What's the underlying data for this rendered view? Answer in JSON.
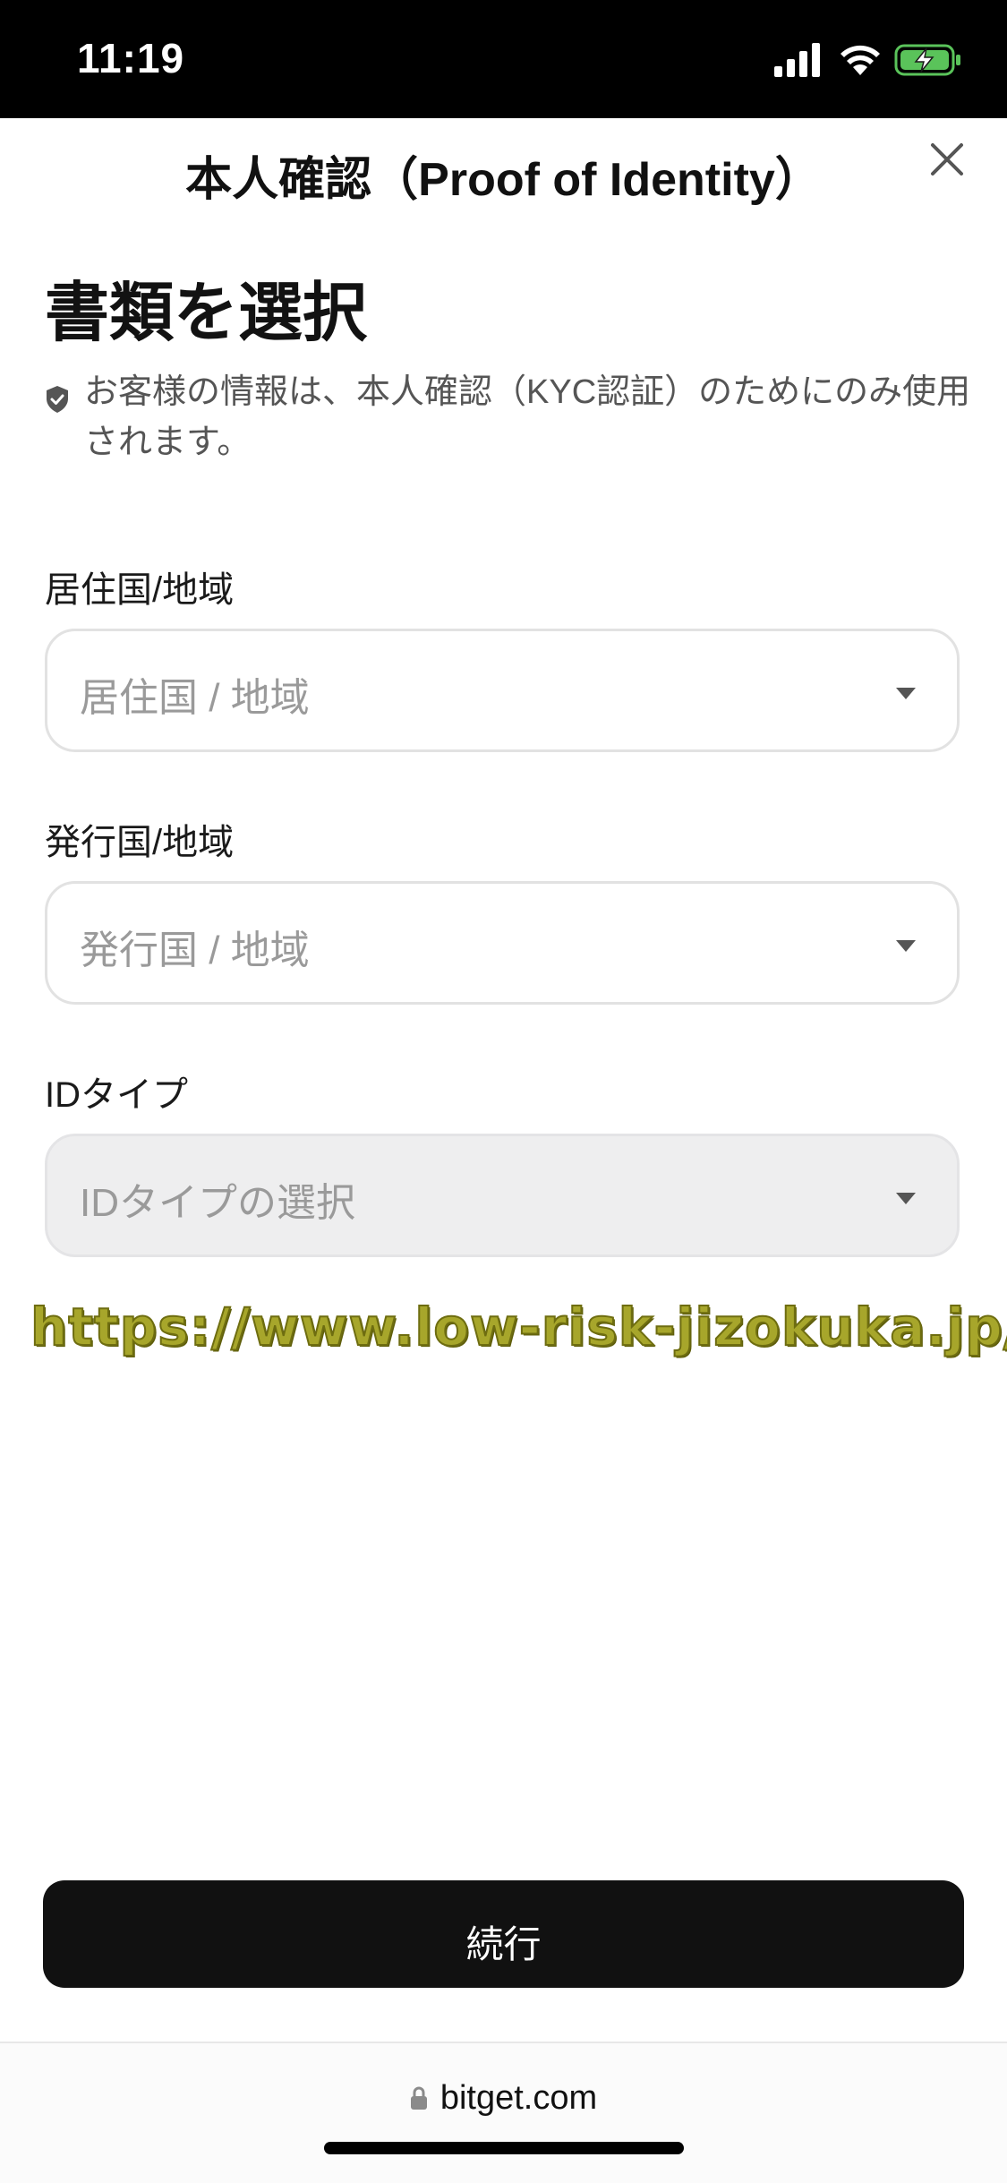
{
  "status_bar": {
    "time": "11:19"
  },
  "header": {
    "title": "本人確認（Proof of Identity）"
  },
  "content": {
    "heading": "書類を選択",
    "privacy_note": "お客様の情報は、本人確認（KYC認証）のためにのみ使用されます。"
  },
  "form": {
    "residence": {
      "label": "居住国/地域",
      "placeholder": "居住国 / 地域"
    },
    "issuing": {
      "label": "発行国/地域",
      "placeholder": "発行国 / 地域"
    },
    "id_type": {
      "label": "IDタイプ",
      "placeholder": "IDタイプの選択",
      "disabled": true
    }
  },
  "watermark": "https://www.low-risk-jizokuka.jp/",
  "actions": {
    "continue_label": "続行"
  },
  "browser": {
    "url": "bitget.com"
  },
  "icons": {
    "signal": "cellular-signal-icon",
    "wifi": "wifi-icon",
    "battery": "battery-charging-icon",
    "close": "close-icon",
    "shield": "shield-icon",
    "chevron": "chevron-down-icon",
    "lock": "lock-icon"
  },
  "colors": {
    "primary_button": "#111111",
    "battery_fill": "#5ac35a",
    "watermark": "#a7a62b"
  }
}
